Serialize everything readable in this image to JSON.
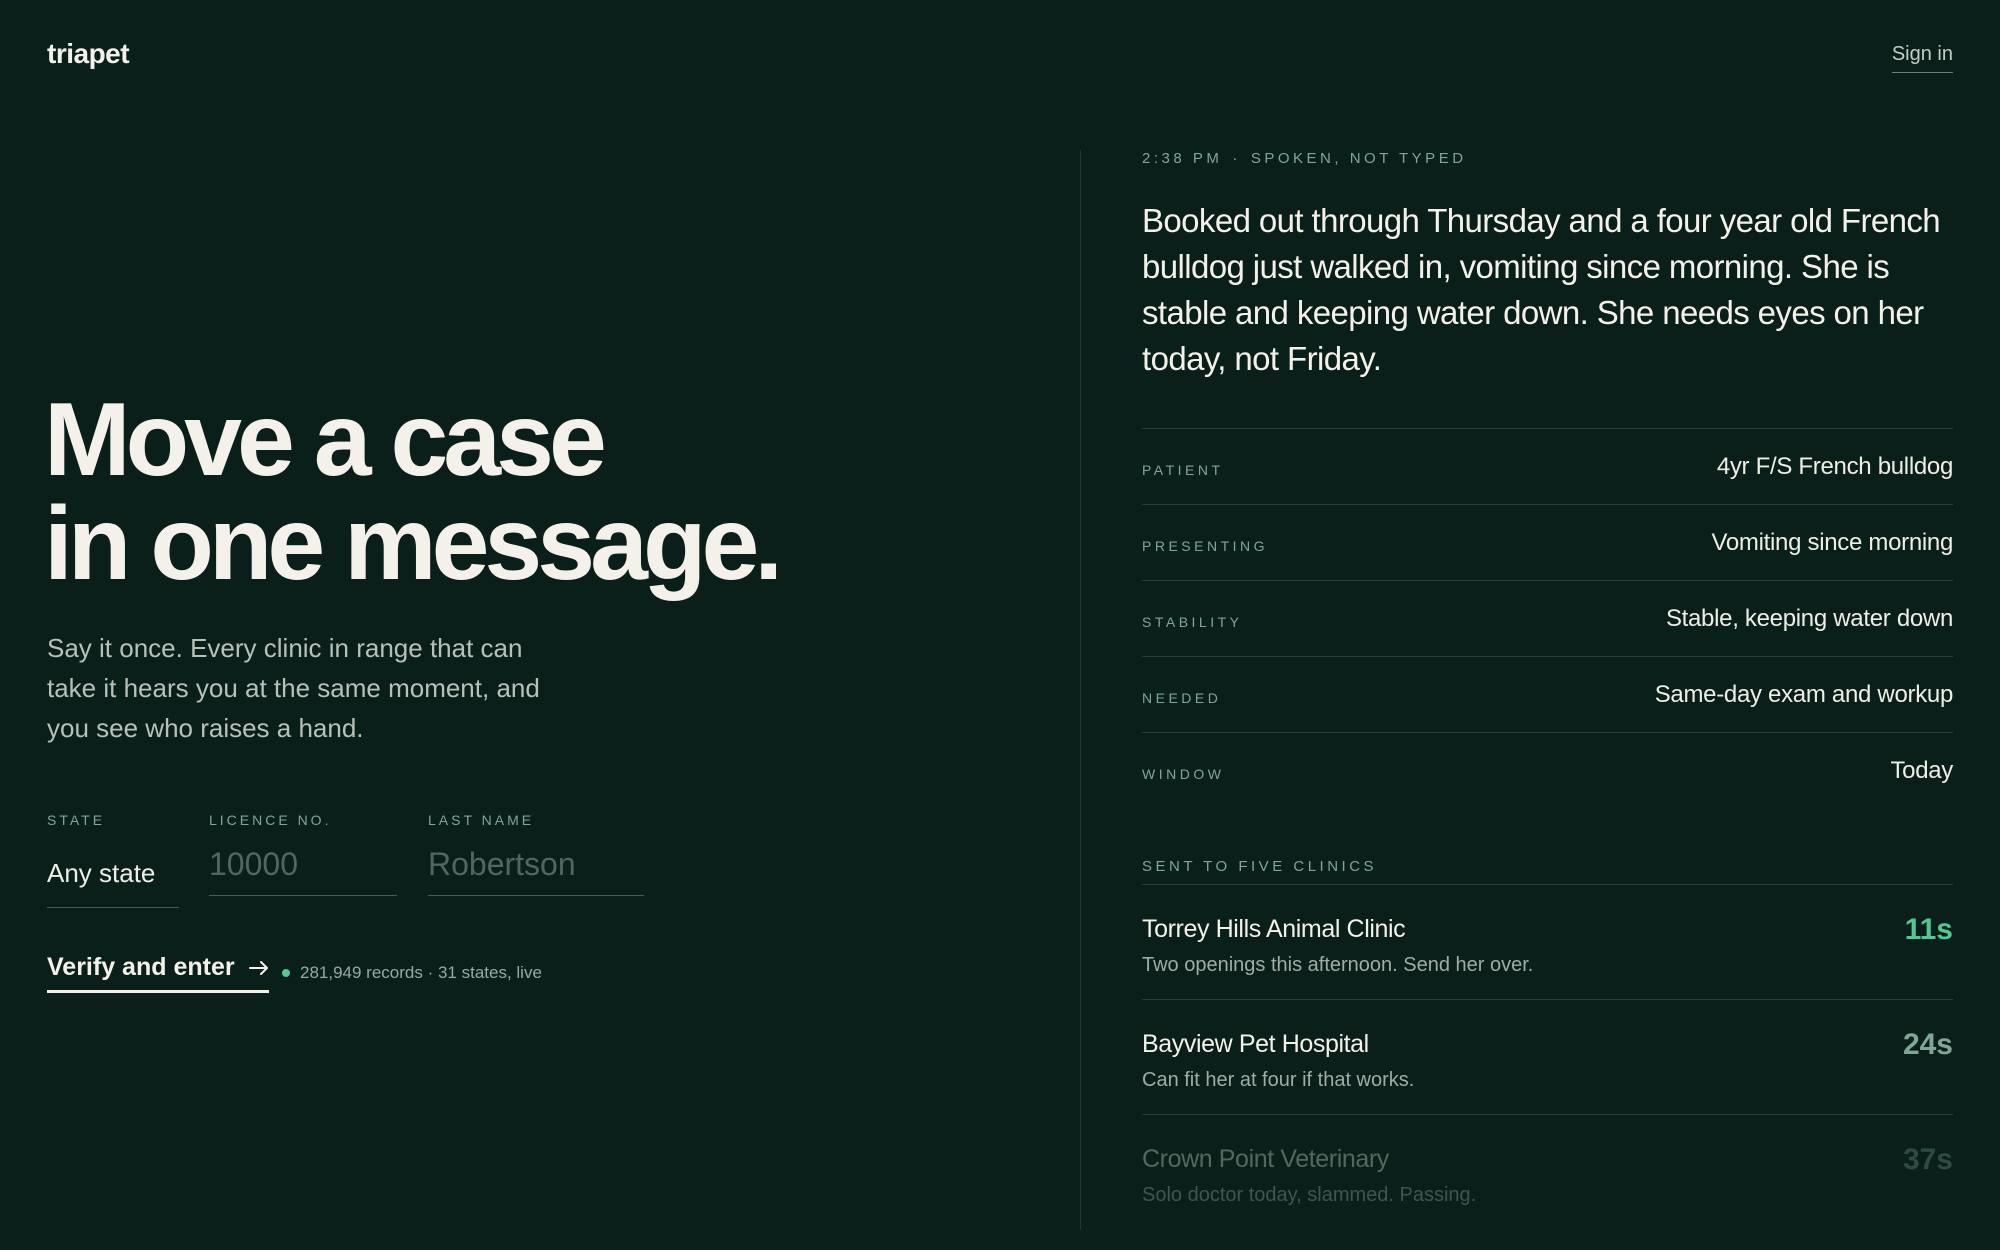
{
  "header": {
    "logo": "triapet",
    "sign_in": "Sign in"
  },
  "hero": {
    "headline_line1": "Move a case",
    "headline_line2": "in one message.",
    "subcopy": "Say it once. Every clinic in range that can take it hears you at the same moment, and you see who raises a hand."
  },
  "form": {
    "state": {
      "label": "STATE",
      "value": "Any state"
    },
    "licence": {
      "label": "LICENCE NO.",
      "placeholder": "10000"
    },
    "last_name": {
      "label": "LAST NAME",
      "placeholder": "Robertson"
    },
    "submit_label": "Verify and enter",
    "records_status": "281,949 records · 31 states, live"
  },
  "message": {
    "time": "2:38 PM",
    "separator": "·",
    "mode": "SPOKEN, NOT TYPED",
    "text": "Booked out through Thursday and a four year old French bulldog just walked in, vomiting since morning. She is stable and keeping water down. She needs eyes on her today, not Friday."
  },
  "details": [
    {
      "key": "PATIENT",
      "value": "4yr F/S French bulldog"
    },
    {
      "key": "PRESENTING",
      "value": "Vomiting since morning"
    },
    {
      "key": "STABILITY",
      "value": "Stable, keeping water down"
    },
    {
      "key": "NEEDED",
      "value": "Same-day exam and workup"
    },
    {
      "key": "WINDOW",
      "value": "Today"
    }
  ],
  "sent": {
    "label": "SENT TO FIVE CLINICS",
    "clinics": [
      {
        "name": "Torrey Hills Animal Clinic",
        "message": "Two openings this afternoon. Send her over.",
        "time": "11s"
      },
      {
        "name": "Bayview Pet Hospital",
        "message": "Can fit her at four if that works.",
        "time": "24s"
      },
      {
        "name": "Crown Point Veterinary",
        "message": "Solo doctor today, slammed. Passing.",
        "time": "37s"
      }
    ]
  },
  "colors": {
    "background": "#0b1f1a",
    "accent_green": "#4ecb92",
    "label_green": "#7fa697",
    "text_primary": "#f3f1ea"
  },
  "icons": {
    "cta": "arrow-right-icon",
    "status": "live-dot-icon"
  }
}
